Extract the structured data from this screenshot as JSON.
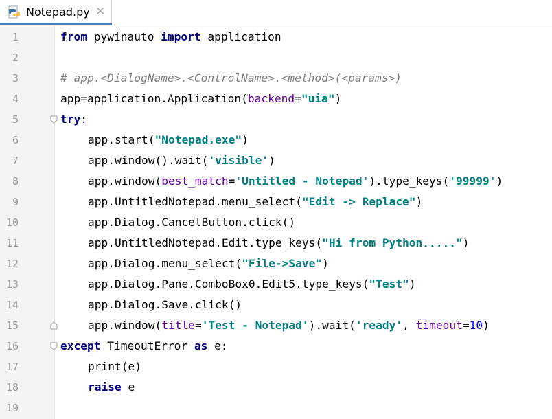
{
  "tab": {
    "title": "Notepad.py",
    "close": "✕"
  },
  "code": {
    "lines": [
      {
        "n": "1",
        "indent": 0,
        "tokens": [
          [
            "kw",
            "from"
          ],
          [
            "plain",
            " pywinauto "
          ],
          [
            "kw",
            "import"
          ],
          [
            "plain",
            " application"
          ]
        ]
      },
      {
        "n": "2",
        "indent": 0,
        "tokens": []
      },
      {
        "n": "3",
        "indent": 0,
        "tokens": [
          [
            "cmt",
            "# app.<DialogName>.<ControlName>.<method>(<params>)"
          ]
        ]
      },
      {
        "n": "4",
        "indent": 0,
        "tokens": [
          [
            "plain",
            "app=application.Application("
          ],
          [
            "param",
            "backend"
          ],
          [
            "plain",
            "="
          ],
          [
            "str",
            "\"uia\""
          ],
          [
            "plain",
            ")"
          ]
        ]
      },
      {
        "n": "5",
        "indent": 0,
        "tokens": [
          [
            "kw",
            "try"
          ],
          [
            "plain",
            ":"
          ]
        ]
      },
      {
        "n": "6",
        "indent": 1,
        "tokens": [
          [
            "plain",
            "app.start("
          ],
          [
            "str",
            "\"Notepad.exe\""
          ],
          [
            "plain",
            ")"
          ]
        ]
      },
      {
        "n": "7",
        "indent": 1,
        "tokens": [
          [
            "plain",
            "app.window().wait("
          ],
          [
            "str",
            "'visible'"
          ],
          [
            "plain",
            ")"
          ]
        ]
      },
      {
        "n": "8",
        "indent": 1,
        "tokens": [
          [
            "plain",
            "app.window("
          ],
          [
            "param",
            "best_match"
          ],
          [
            "plain",
            "="
          ],
          [
            "str",
            "'Untitled - Notepad'"
          ],
          [
            "plain",
            ").type_keys("
          ],
          [
            "str",
            "'99999'"
          ],
          [
            "plain",
            ")"
          ]
        ]
      },
      {
        "n": "9",
        "indent": 1,
        "tokens": [
          [
            "plain",
            "app.UntitledNotepad.menu_select("
          ],
          [
            "str",
            "\"Edit -> Replace\""
          ],
          [
            "plain",
            ")"
          ]
        ]
      },
      {
        "n": "10",
        "indent": 1,
        "tokens": [
          [
            "plain",
            "app.Dialog.CancelButton.click()"
          ]
        ]
      },
      {
        "n": "11",
        "indent": 1,
        "tokens": [
          [
            "plain",
            "app.UntitledNotepad.Edit.type_keys("
          ],
          [
            "str",
            "\"Hi from Python.....\""
          ],
          [
            "plain",
            ")"
          ]
        ]
      },
      {
        "n": "12",
        "indent": 1,
        "tokens": [
          [
            "plain",
            "app.Dialog.menu_select("
          ],
          [
            "str",
            "\"File->Save\""
          ],
          [
            "plain",
            ")"
          ]
        ]
      },
      {
        "n": "13",
        "indent": 1,
        "tokens": [
          [
            "plain",
            "app.Dialog.Pane.ComboBox0.Edit5.type_keys("
          ],
          [
            "str",
            "\"Test\""
          ],
          [
            "plain",
            ")"
          ]
        ]
      },
      {
        "n": "14",
        "indent": 1,
        "tokens": [
          [
            "plain",
            "app.Dialog.Save.click()"
          ]
        ]
      },
      {
        "n": "15",
        "indent": 1,
        "tokens": [
          [
            "plain",
            "app.window("
          ],
          [
            "param",
            "title"
          ],
          [
            "plain",
            "="
          ],
          [
            "str",
            "'Test - Notepad'"
          ],
          [
            "plain",
            ").wait("
          ],
          [
            "str",
            "'ready'"
          ],
          [
            "plain",
            ", "
          ],
          [
            "param",
            "timeout"
          ],
          [
            "plain",
            "="
          ],
          [
            "numlit",
            "10"
          ],
          [
            "plain",
            ")"
          ]
        ]
      },
      {
        "n": "16",
        "indent": 0,
        "tokens": [
          [
            "kw",
            "except"
          ],
          [
            "plain",
            " TimeoutError "
          ],
          [
            "kw",
            "as"
          ],
          [
            "plain",
            " e:"
          ]
        ]
      },
      {
        "n": "17",
        "indent": 1,
        "tokens": [
          [
            "plain",
            "print(e)"
          ]
        ]
      },
      {
        "n": "18",
        "indent": 1,
        "tokens": [
          [
            "kw",
            "raise"
          ],
          [
            "plain",
            " e"
          ]
        ]
      },
      {
        "n": "19",
        "indent": 0,
        "tokens": []
      }
    ]
  },
  "colors": {
    "keyword": "#000080",
    "string": "#008080",
    "comment": "#808080",
    "param": "#660099",
    "number": "#0000ff",
    "accent": "#4083c9"
  },
  "icons": {
    "file": "python-file-icon",
    "close": "close-icon",
    "fold": "fold-marker-icon"
  }
}
